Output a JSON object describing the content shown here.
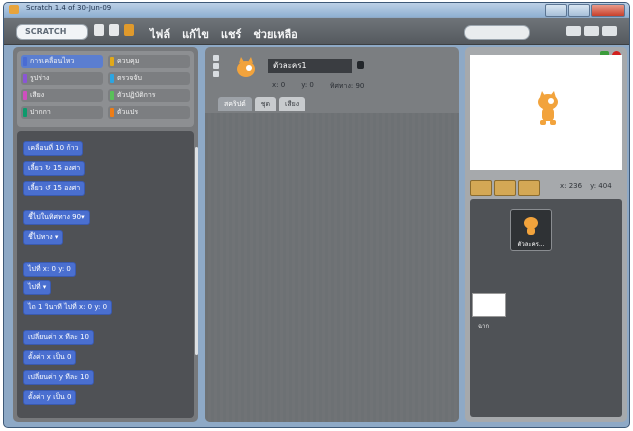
{
  "window": {
    "title": "Scratch 1.4 of 30-Jun-09"
  },
  "menu": [
    "ไฟล์",
    "แก้ไข",
    "แชร์",
    "ช่วยเหลือ"
  ],
  "categories": [
    {
      "label": "การเคลื่อนไหว",
      "selected": true,
      "color": "#4a6cd4"
    },
    {
      "label": "ควบคุม",
      "selected": false,
      "color": "#e1a91a"
    },
    {
      "label": "รูปร่าง",
      "selected": false,
      "color": "#8a55d7"
    },
    {
      "label": "ตรวจจับ",
      "selected": false,
      "color": "#2ca5e2"
    },
    {
      "label": "เสียง",
      "selected": false,
      "color": "#cf4ebf"
    },
    {
      "label": "ตัวปฏิบัติการ",
      "selected": false,
      "color": "#59c059"
    },
    {
      "label": "ปากกา",
      "selected": false,
      "color": "#0e9a6c"
    },
    {
      "label": "ตัวแปร",
      "selected": false,
      "color": "#ee7d16"
    }
  ],
  "blocks": [
    "เคลื่อนที่ 10 ก้าว",
    "เลี้ยว ↻ 15 องศา",
    "เลี้ยว ↺ 15 องศา",
    "ชี้ไปในทิศทาง 90▾",
    "ชี้ไปทาง ▾",
    "ไปที่ x: 0 y: 0",
    "ไปที่ ▾",
    "ไถ 1 วินาที ไปที่ x: 0 y: 0",
    "เปลี่ยนค่า x ทีละ 10",
    "ตั้งค่า x เป็น 0",
    "เปลี่ยนค่า y ทีละ 10",
    "ตั้งค่า y เป็น 0"
  ],
  "sprite": {
    "name": "ตัวละคร1",
    "x": "x: 0",
    "y": "y: 0",
    "direction": "ทิศทาง: 90"
  },
  "tabs": [
    "สคริปต์",
    "ชุด",
    "เสียง"
  ],
  "stage": {
    "mouse_x": "x: 236",
    "mouse_y": "y: 404"
  },
  "sprites": [
    {
      "label": "ตัวละคร..."
    }
  ],
  "stage_label": "ฉาก"
}
